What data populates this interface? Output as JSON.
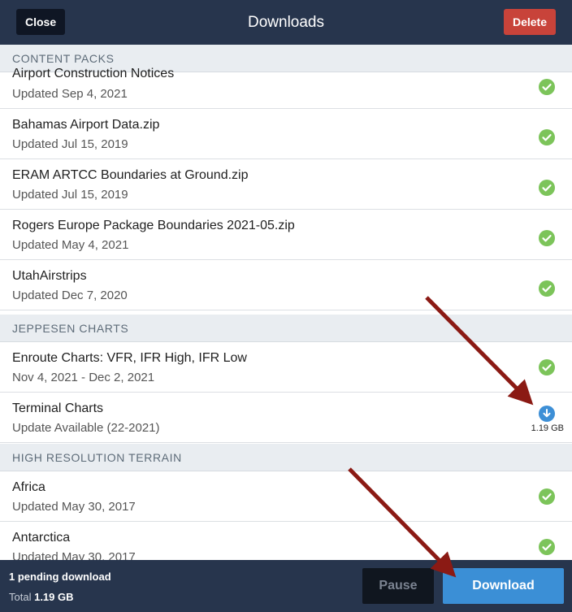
{
  "header": {
    "title": "Downloads",
    "close_label": "Close",
    "delete_label": "Delete"
  },
  "sections": [
    {
      "title": "CONTENT PACKS",
      "items": [
        {
          "name": "Airport Construction Notices",
          "sub": "Updated Sep 4, 2021",
          "status": "check-icon"
        },
        {
          "name": "Bahamas Airport Data.zip",
          "sub": "Updated Jul 15, 2019",
          "status": "check-icon"
        },
        {
          "name": "ERAM ARTCC Boundaries at Ground.zip",
          "sub": "Updated Jul 15, 2019",
          "status": "check-icon"
        },
        {
          "name": "Rogers Europe Package Boundaries 2021-05.zip",
          "sub": "Updated May 4, 2021",
          "status": "check-icon"
        },
        {
          "name": "UtahAirstrips",
          "sub": "Updated Dec 7, 2020",
          "status": "check-icon"
        }
      ]
    },
    {
      "title": "JEPPESEN CHARTS",
      "items": [
        {
          "name": "Enroute Charts:  VFR, IFR High, IFR Low",
          "sub": "Nov 4, 2021 - Dec 2, 2021",
          "status": "check-icon"
        },
        {
          "name": "Terminal Charts",
          "sub": "Update Available (22-2021)",
          "status": "download-icon",
          "size": "1.19 GB"
        }
      ]
    },
    {
      "title": "HIGH RESOLUTION TERRAIN",
      "items": [
        {
          "name": "Africa",
          "sub": "Updated May 30, 2017",
          "status": "check-icon"
        },
        {
          "name": "Antarctica",
          "sub": "Updated May 30, 2017",
          "status": "check-icon"
        }
      ]
    }
  ],
  "footer": {
    "pending": "1 pending download",
    "total_label": "Total",
    "total_value": "1.19 GB",
    "pause_label": "Pause",
    "download_label": "Download"
  },
  "colors": {
    "header_bg": "#27354d",
    "delete": "#c8433a",
    "check": "#7cc45a",
    "download_accent": "#3b8fd6",
    "annotation_arrow": "#8b1a14"
  }
}
